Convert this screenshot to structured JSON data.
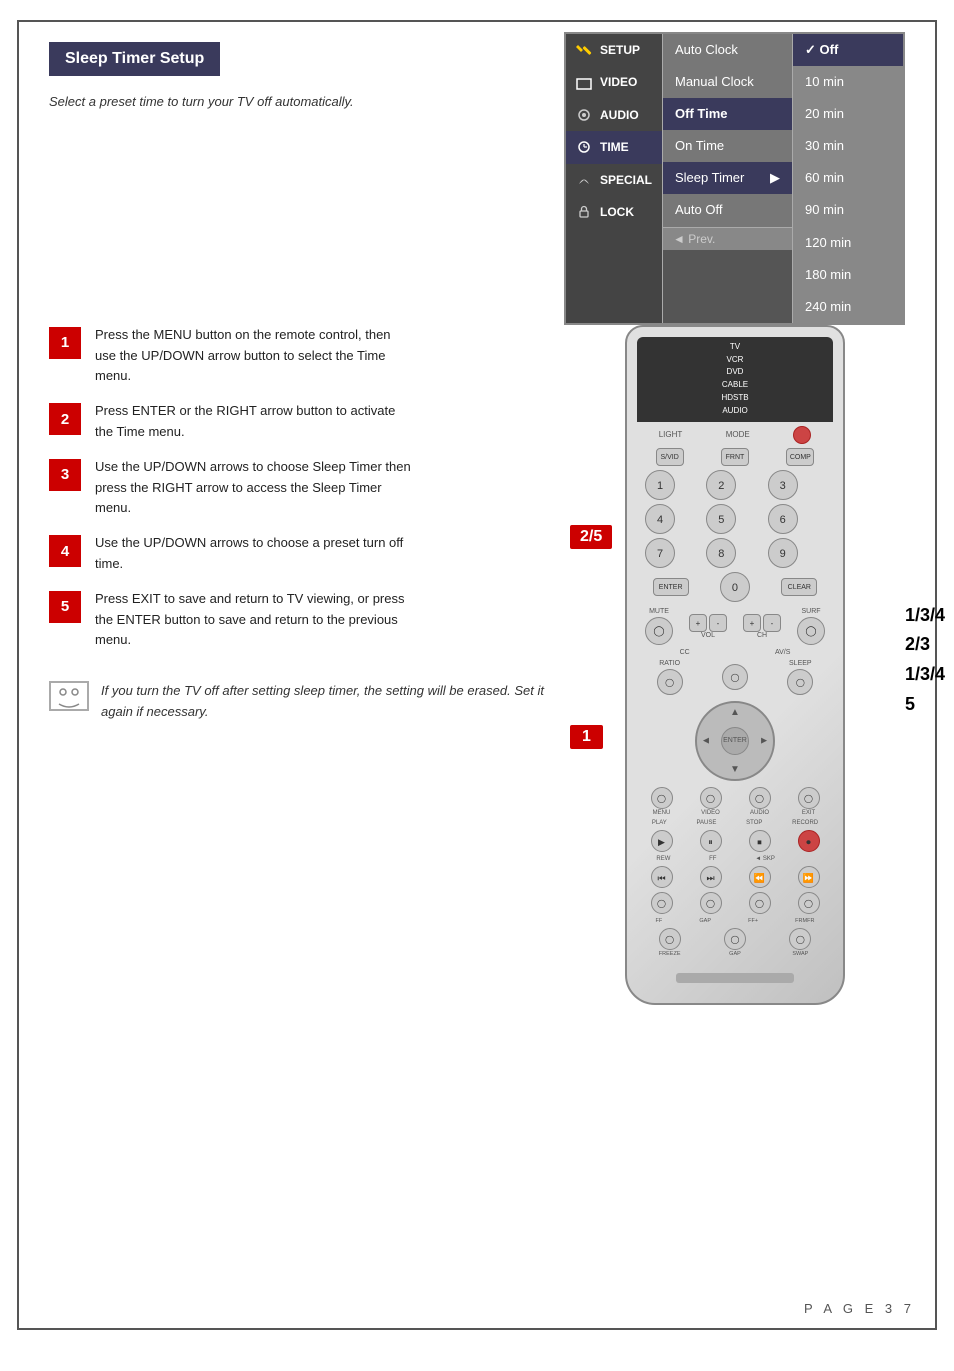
{
  "page": {
    "title": "Sleep Timer Setup",
    "subtitle": "Select a preset time to turn your TV off automatically.",
    "page_number": "P A G E   3 7"
  },
  "menu": {
    "left_column": [
      {
        "label": "SETUP",
        "icon": "wrench"
      },
      {
        "label": "VIDEO",
        "icon": "square"
      },
      {
        "label": "AUDIO",
        "icon": "audio"
      },
      {
        "label": "TIME",
        "icon": "clock",
        "active": true
      },
      {
        "label": "SPECIAL",
        "icon": "special"
      },
      {
        "label": "LOCK",
        "icon": "lock"
      }
    ],
    "mid_column": [
      {
        "label": "Auto Clock"
      },
      {
        "label": "Manual Clock"
      },
      {
        "label": "Off Time"
      },
      {
        "label": "On Time"
      },
      {
        "label": "Sleep Timer",
        "active": true,
        "arrow": "▶"
      },
      {
        "label": "Auto Off"
      }
    ],
    "right_column": [
      {
        "label": "✓ Off",
        "checked": true
      },
      {
        "label": "10 min"
      },
      {
        "label": "20 min"
      },
      {
        "label": "30 min"
      },
      {
        "label": "60 min"
      },
      {
        "label": "90 min"
      },
      {
        "label": "120 min"
      },
      {
        "label": "180 min"
      },
      {
        "label": "240 min"
      }
    ],
    "prev_label": "◄ Prev."
  },
  "steps": [
    {
      "number": "1",
      "text": "Press the MENU button on the remote control, then use the UP/DOWN arrow button to select the Time menu."
    },
    {
      "number": "2",
      "text": "Press ENTER or the RIGHT arrow button to activate the Time menu."
    },
    {
      "number": "3",
      "text": "Use the UP/DOWN arrows to choose Sleep Timer then press the RIGHT arrow to access the Sleep Timer menu."
    },
    {
      "number": "4",
      "text": "Use the UP/DOWN arrows to choose a preset turn off time."
    },
    {
      "number": "5",
      "text": "Press EXIT to save and return to TV viewing, or press the ENTER button to save and return to the previous menu."
    }
  ],
  "remote": {
    "top_labels": [
      "TV",
      "VCR",
      "DVD",
      "CABLE",
      "HDSTB",
      "AUDIO"
    ],
    "badge_25": "2/5",
    "badge_1": "1",
    "right_labels_top": [
      "1/3/4",
      "2/3",
      "1/3/4",
      "5"
    ]
  },
  "note": {
    "icon": "😊",
    "text": "If you turn the TV off after setting sleep timer, the setting will be erased. Set it again if necessary."
  }
}
